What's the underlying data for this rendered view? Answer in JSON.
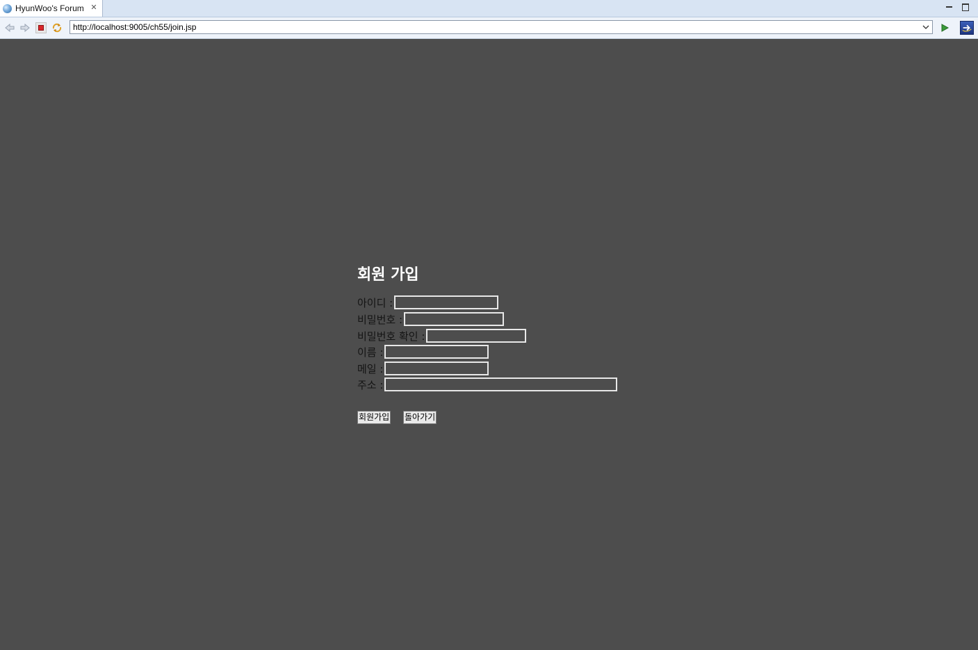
{
  "browser": {
    "tab_title": "HyunWoo's Forum",
    "url": "http://localhost:9005/ch55/join.jsp"
  },
  "form": {
    "heading": "회원 가입",
    "fields": [
      {
        "label": "아이디 :",
        "value": ""
      },
      {
        "label": "비밀번호 :",
        "value": ""
      },
      {
        "label": "비밀번호 확인 :",
        "value": ""
      },
      {
        "label": "이름 :",
        "value": ""
      },
      {
        "label": "메일 :",
        "value": ""
      },
      {
        "label": "주소 :",
        "value": ""
      }
    ],
    "submit_label": "회원가입",
    "back_label": "돌아가기"
  },
  "colors": {
    "page_background": "#4d4d4d",
    "heading_text": "#ffffff",
    "field_border": "#e8e8e8"
  },
  "icons": {
    "tab": "globe-icon",
    "back": "back-arrow-icon",
    "forward": "forward-arrow-icon",
    "stop": "stop-icon",
    "refresh": "refresh-icon",
    "go": "play-icon"
  }
}
